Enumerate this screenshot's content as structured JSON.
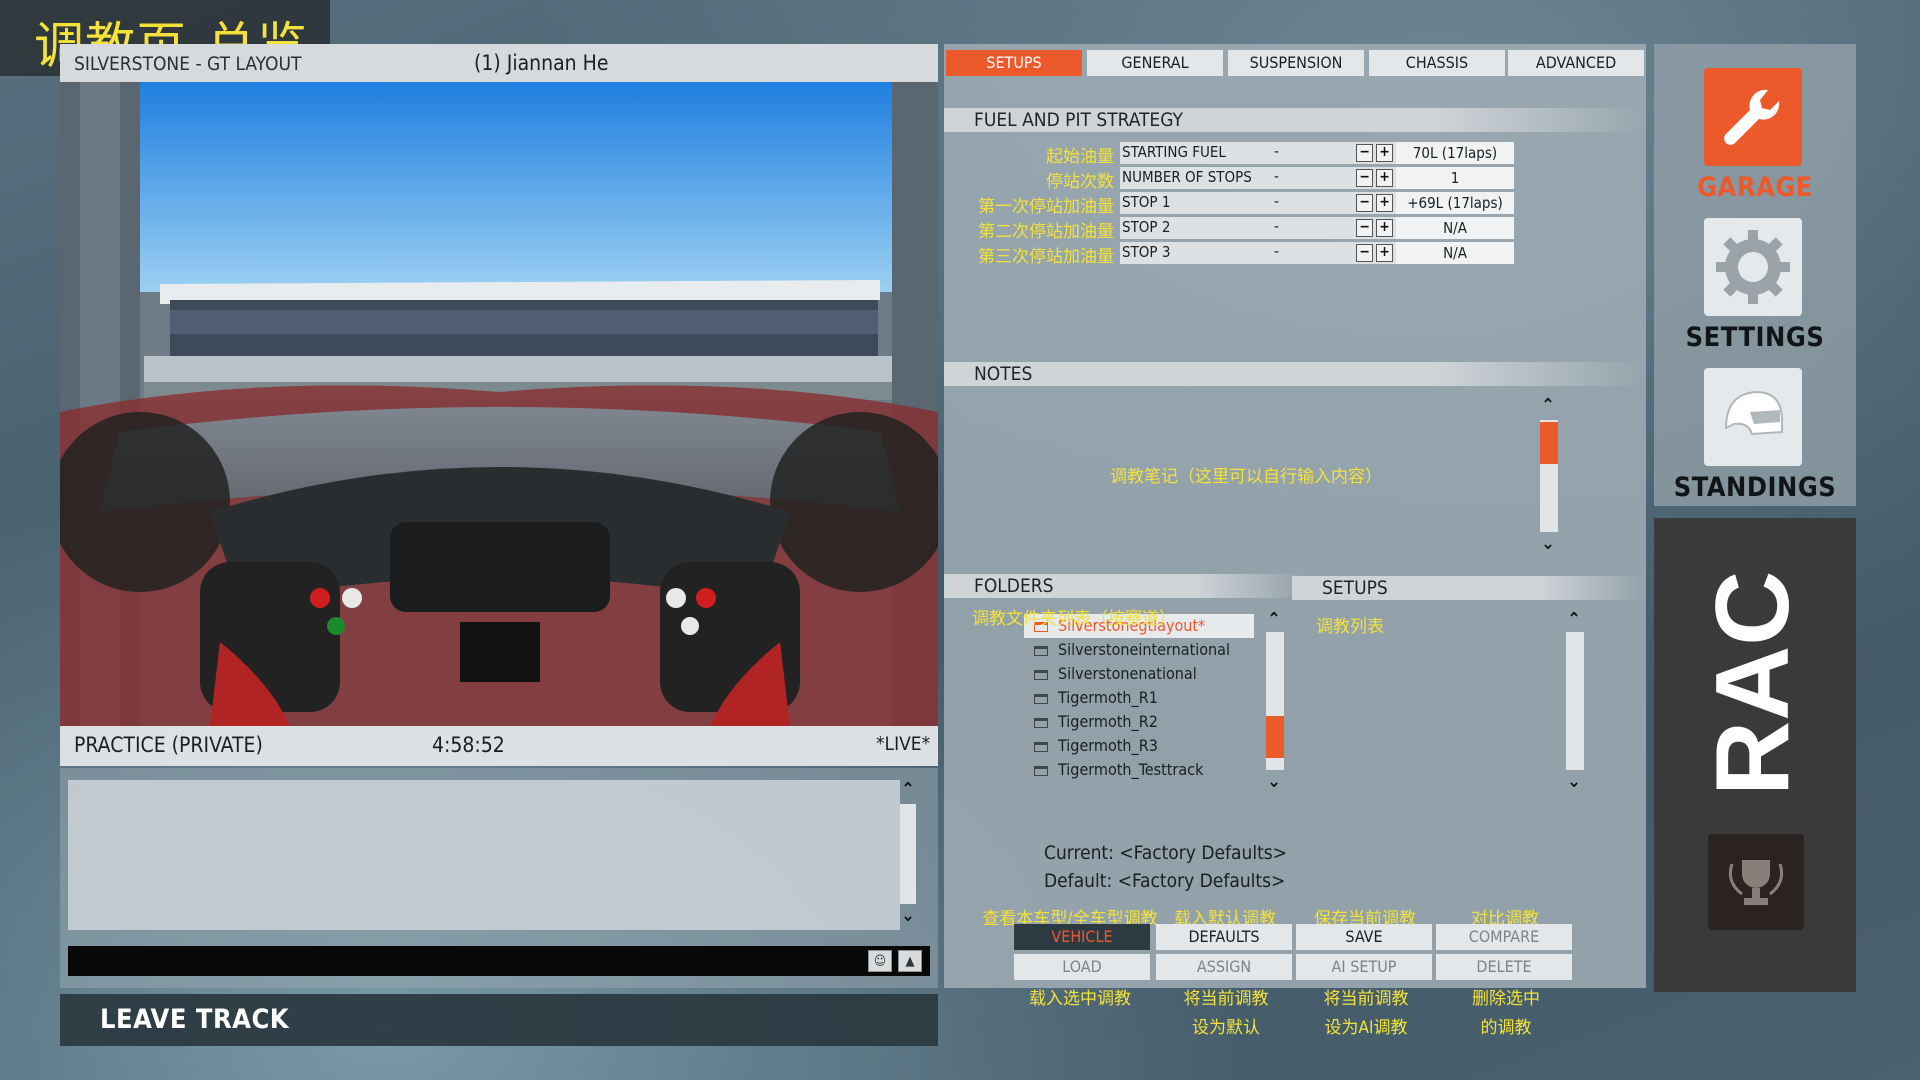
{
  "title_banner": "调教页-总览",
  "left": {
    "track": "SILVERSTONE - GT LAYOUT",
    "driver": "(1) Jiannan He",
    "session_type": "PRACTICE (PRIVATE)",
    "session_time": "4:58:52",
    "live": "*LIVE*",
    "leave_track": "LEAVE TRACK"
  },
  "tabs": [
    {
      "label": "SETUPS",
      "active": true
    },
    {
      "label": "GENERAL",
      "active": false
    },
    {
      "label": "SUSPENSION",
      "active": false
    },
    {
      "label": "CHASSIS",
      "active": false
    },
    {
      "label": "ADVANCED",
      "active": false
    }
  ],
  "fuel": {
    "section_title": "FUEL AND PIT STRATEGY",
    "rows": [
      {
        "cn": "起始油量",
        "en": "STARTING FUEL",
        "dash": "-",
        "value": "70L (17laps)"
      },
      {
        "cn": "停站次数",
        "en": "NUMBER OF STOPS",
        "dash": "-",
        "value": "1"
      },
      {
        "cn": "第一次停站加油量",
        "en": "STOP 1",
        "dash": "-",
        "value": "+69L (17laps)"
      },
      {
        "cn": "第二次停站加油量",
        "en": "STOP 2",
        "dash": "-",
        "value": "N/A"
      },
      {
        "cn": "第三次停站加油量",
        "en": "STOP 3",
        "dash": "-",
        "value": "N/A"
      }
    ]
  },
  "notes": {
    "section_title": "NOTES",
    "annotation": "调教笔记（这里可以自行输入内容）"
  },
  "folders": {
    "section_title": "FOLDERS",
    "annotation": "调教文件夹列表（按赛道）",
    "items": [
      {
        "label": "Silverstonegtlayout*",
        "selected": true
      },
      {
        "label": "Silverstoneinternational",
        "selected": false
      },
      {
        "label": "Silverstonenational",
        "selected": false
      },
      {
        "label": "Tigermoth_R1",
        "selected": false
      },
      {
        "label": "Tigermoth_R2",
        "selected": false
      },
      {
        "label": "Tigermoth_R3",
        "selected": false
      },
      {
        "label": "Tigermoth_Testtrack",
        "selected": false
      }
    ]
  },
  "setups": {
    "section_title": "SETUPS",
    "annotation": "调教列表"
  },
  "current": "Current: <Factory Defaults>",
  "default": "Default: <Factory Defaults>",
  "buttons": {
    "top_annotations": [
      "查看本车型/全车型调教",
      "载入默认调教",
      "保存当前调教",
      "对比调教"
    ],
    "row1": [
      {
        "label": "VEHICLE",
        "state": "active"
      },
      {
        "label": "DEFAULTS",
        "state": "normal"
      },
      {
        "label": "SAVE",
        "state": "normal"
      },
      {
        "label": "COMPARE",
        "state": "dim"
      }
    ],
    "row2": [
      {
        "label": "LOAD",
        "state": "dim"
      },
      {
        "label": "ASSIGN",
        "state": "dim"
      },
      {
        "label": "AI SETUP",
        "state": "dim"
      },
      {
        "label": "DELETE",
        "state": "dim"
      }
    ],
    "bottom_annotations": [
      [
        "载入选中调教",
        ""
      ],
      [
        "将当前调教",
        "设为默认"
      ],
      [
        "将当前调教",
        "设为AI调教"
      ],
      [
        "删除选中",
        "的调教"
      ]
    ]
  },
  "nav": {
    "garage": "GARAGE",
    "settings": "SETTINGS",
    "standings": "STANDINGS",
    "race": "RACE"
  },
  "colors": {
    "accent": "#ec5a2c",
    "annotation": "#f4e23a"
  }
}
